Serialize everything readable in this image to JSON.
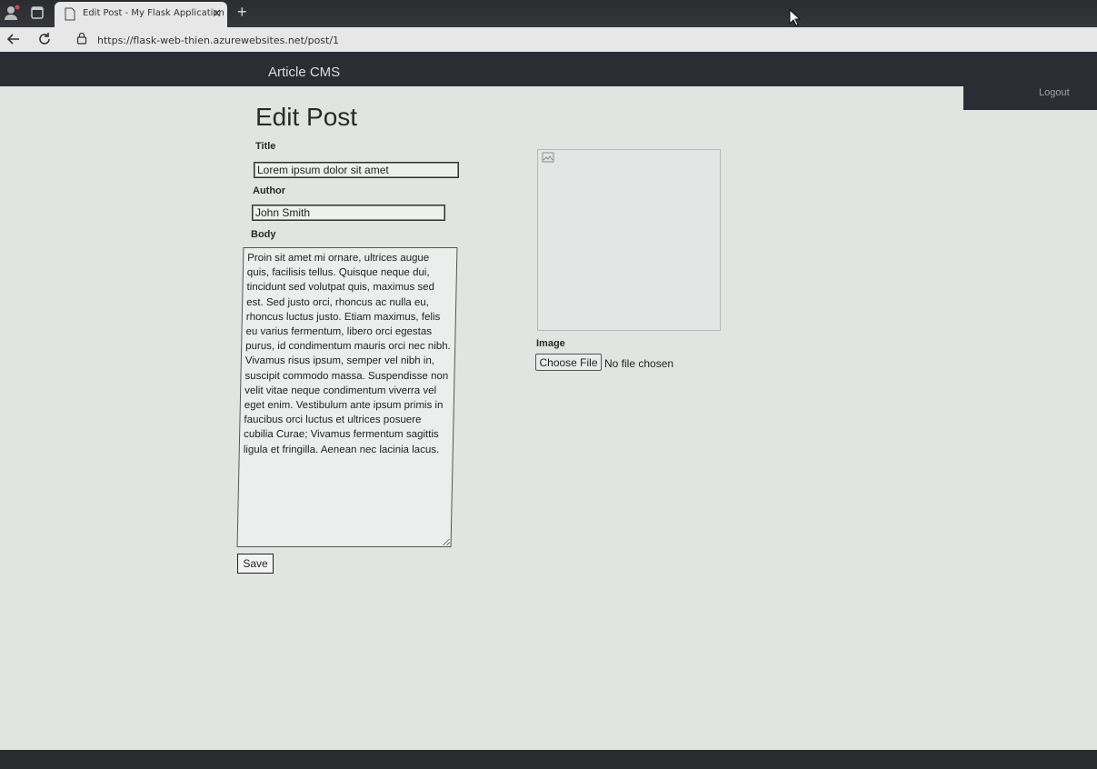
{
  "browser": {
    "tab_title": "Edit Post - My Flask Application",
    "tab_close": "✕",
    "new_tab": "+",
    "url": "https://flask-web-thien.azurewebsites.net/post/1"
  },
  "header": {
    "brand": "Article CMS",
    "logout": "Logout"
  },
  "form": {
    "heading": "Edit Post",
    "title_label": "Title",
    "title_value": "Lorem ipsum dolor sit amet",
    "author_label": "Author",
    "author_value": "John Smith",
    "body_label": "Body",
    "body_value": "Proin sit amet mi ornare, ultrices augue quis, facilisis tellus. Quisque neque dui, tincidunt sed volutpat quis, maximus sed est. Sed justo orci, rhoncus ac nulla eu, rhoncus luctus justo. Etiam maximus, felis eu varius fermentum, libero orci egestas purus, id condimentum mauris orci nec nibh. Vivamus risus ipsum, semper vel nibh in, suscipit commodo massa. Suspendisse non velit vitae neque condimentum viverra vel eget enim. Vestibulum ante ipsum primis in faucibus orci luctus et ultrices posuere cubilia Curae; Vivamus fermentum sagittis ligula et fringilla. Aenean nec lacinia lacus.",
    "save_label": "Save",
    "image_label": "Image",
    "choose_file_label": "Choose File",
    "no_file_text": "No file chosen"
  },
  "icons": {
    "profile": "profile-icon",
    "tabs": "tab-actions-icon",
    "page": "page-icon",
    "back": "back-arrow-icon",
    "reload": "reload-icon",
    "lock": "lock-icon",
    "broken_image": "broken-image-icon"
  }
}
